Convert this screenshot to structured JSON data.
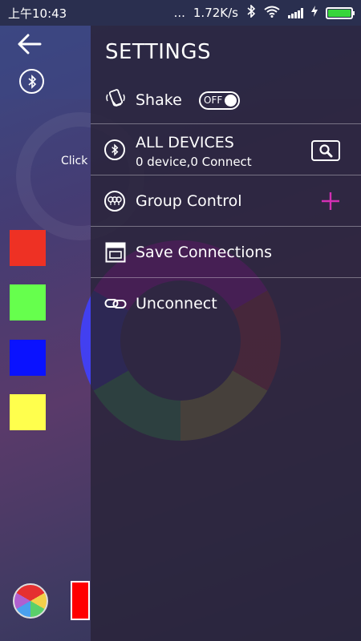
{
  "status_bar": {
    "time": "上午10:43",
    "dots": "...",
    "speed": "1.72K/s",
    "bluetooth_icon": "bluetooth-icon",
    "wifi_icon": "wifi-icon",
    "signal_icon": "signal-icon",
    "charging_icon": "charging-icon",
    "battery_icon": "battery-icon"
  },
  "main": {
    "click_text": "Click",
    "swatch_colors": [
      "#ee3124",
      "#66ff4d",
      "#0a12ff",
      "#ffff4d"
    ],
    "current_color": "#ff0000"
  },
  "drawer": {
    "title": "SETTINGS",
    "shake": {
      "label": "Shake",
      "toggle_text": "OFF",
      "icon": "shake-phone-icon"
    },
    "devices": {
      "label": "ALL DEVICES",
      "subtitle": "0 device,0 Connect",
      "icon": "bluetooth-icon"
    },
    "group": {
      "label": "Group Control",
      "icon": "group-bulbs-icon",
      "add_icon": "plus-icon",
      "accent": "#d32fb4"
    },
    "save": {
      "label": "Save Connections",
      "icon": "save-window-icon"
    },
    "unconnect": {
      "label": "Unconnect",
      "icon": "link-icon"
    }
  }
}
